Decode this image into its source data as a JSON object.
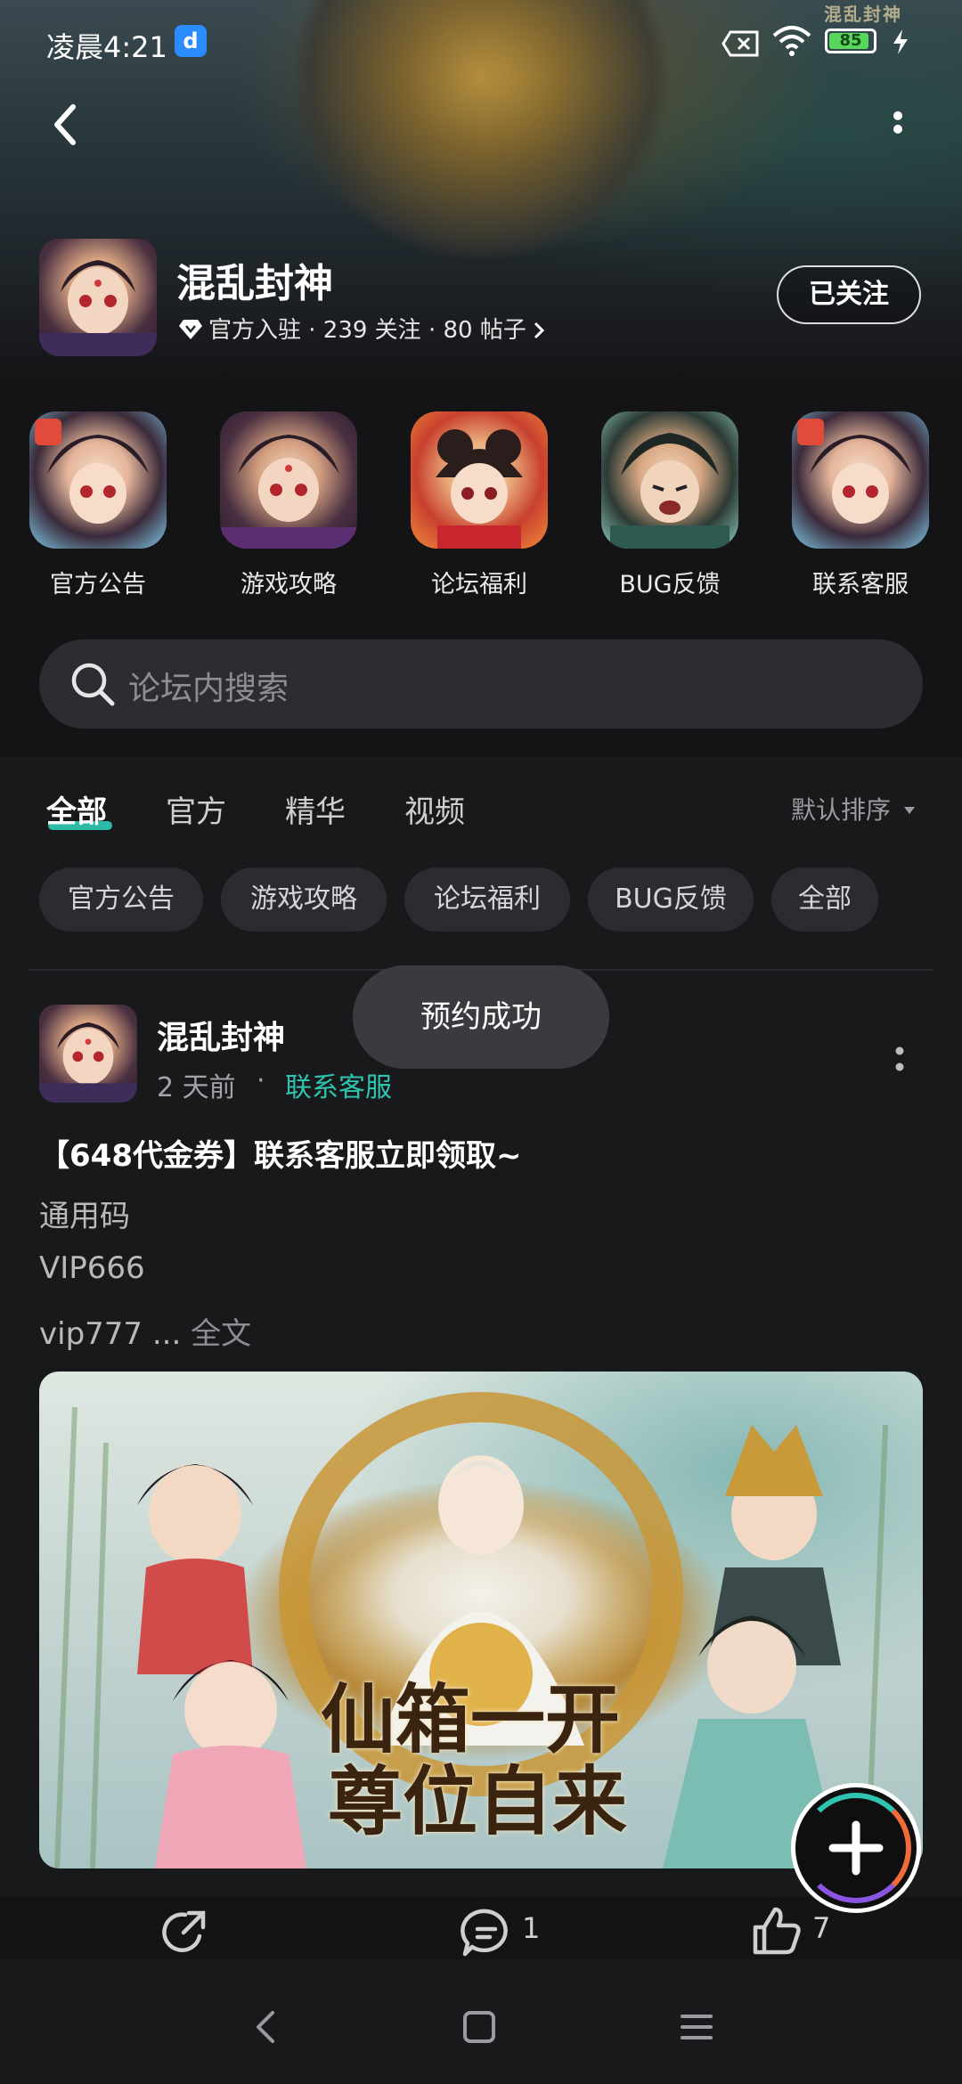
{
  "status_bar": {
    "time": "凌晨4:21",
    "app_badge": "d",
    "battery": "85"
  },
  "header": {
    "corner_logo": "混乱封神"
  },
  "game": {
    "title": "混乱封神",
    "meta": "官方入驻 · 239 关注 · 80 帖子",
    "follow_label": "已关注"
  },
  "quick_entries": [
    {
      "label": "官方公告"
    },
    {
      "label": "游戏攻略"
    },
    {
      "label": "论坛福利"
    },
    {
      "label": "BUG反馈"
    },
    {
      "label": "联系客服"
    }
  ],
  "search": {
    "placeholder": "论坛内搜索"
  },
  "tabs": [
    {
      "label": "全部"
    },
    {
      "label": "官方"
    },
    {
      "label": "精华"
    },
    {
      "label": "视频"
    }
  ],
  "sort_label": "默认排序",
  "chips": [
    {
      "label": "官方公告"
    },
    {
      "label": "游戏攻略"
    },
    {
      "label": "论坛福利"
    },
    {
      "label": "BUG反馈"
    },
    {
      "label": "全部"
    }
  ],
  "post": {
    "author": "混乱封神",
    "time": "2 天前",
    "separator": "·",
    "category": "联系客服",
    "title": "【648代金券】联系客服立即领取~",
    "lines": [
      "通用码",
      "VIP666",
      "vip777 ..."
    ],
    "full_text_label": "全文",
    "image_caption_line1": "仙箱一开",
    "image_caption_line2": "尊位自来",
    "comment_count": "1",
    "like_count": "7"
  },
  "toast": "预约成功",
  "colors": {
    "accent": "#2ec4b0",
    "background": "#141416",
    "panel": "#18191b",
    "chip": "#2b2c30"
  },
  "icons": [
    "back-icon",
    "more-vertical-icon",
    "verified-diamond-icon",
    "chevron-right-icon",
    "search-icon",
    "sort-caret-icon",
    "share-icon",
    "comment-icon",
    "like-icon",
    "plus-icon",
    "nav-back-icon",
    "nav-home-icon",
    "nav-menu-icon",
    "wifi-icon",
    "sim-x-icon",
    "charging-icon"
  ]
}
